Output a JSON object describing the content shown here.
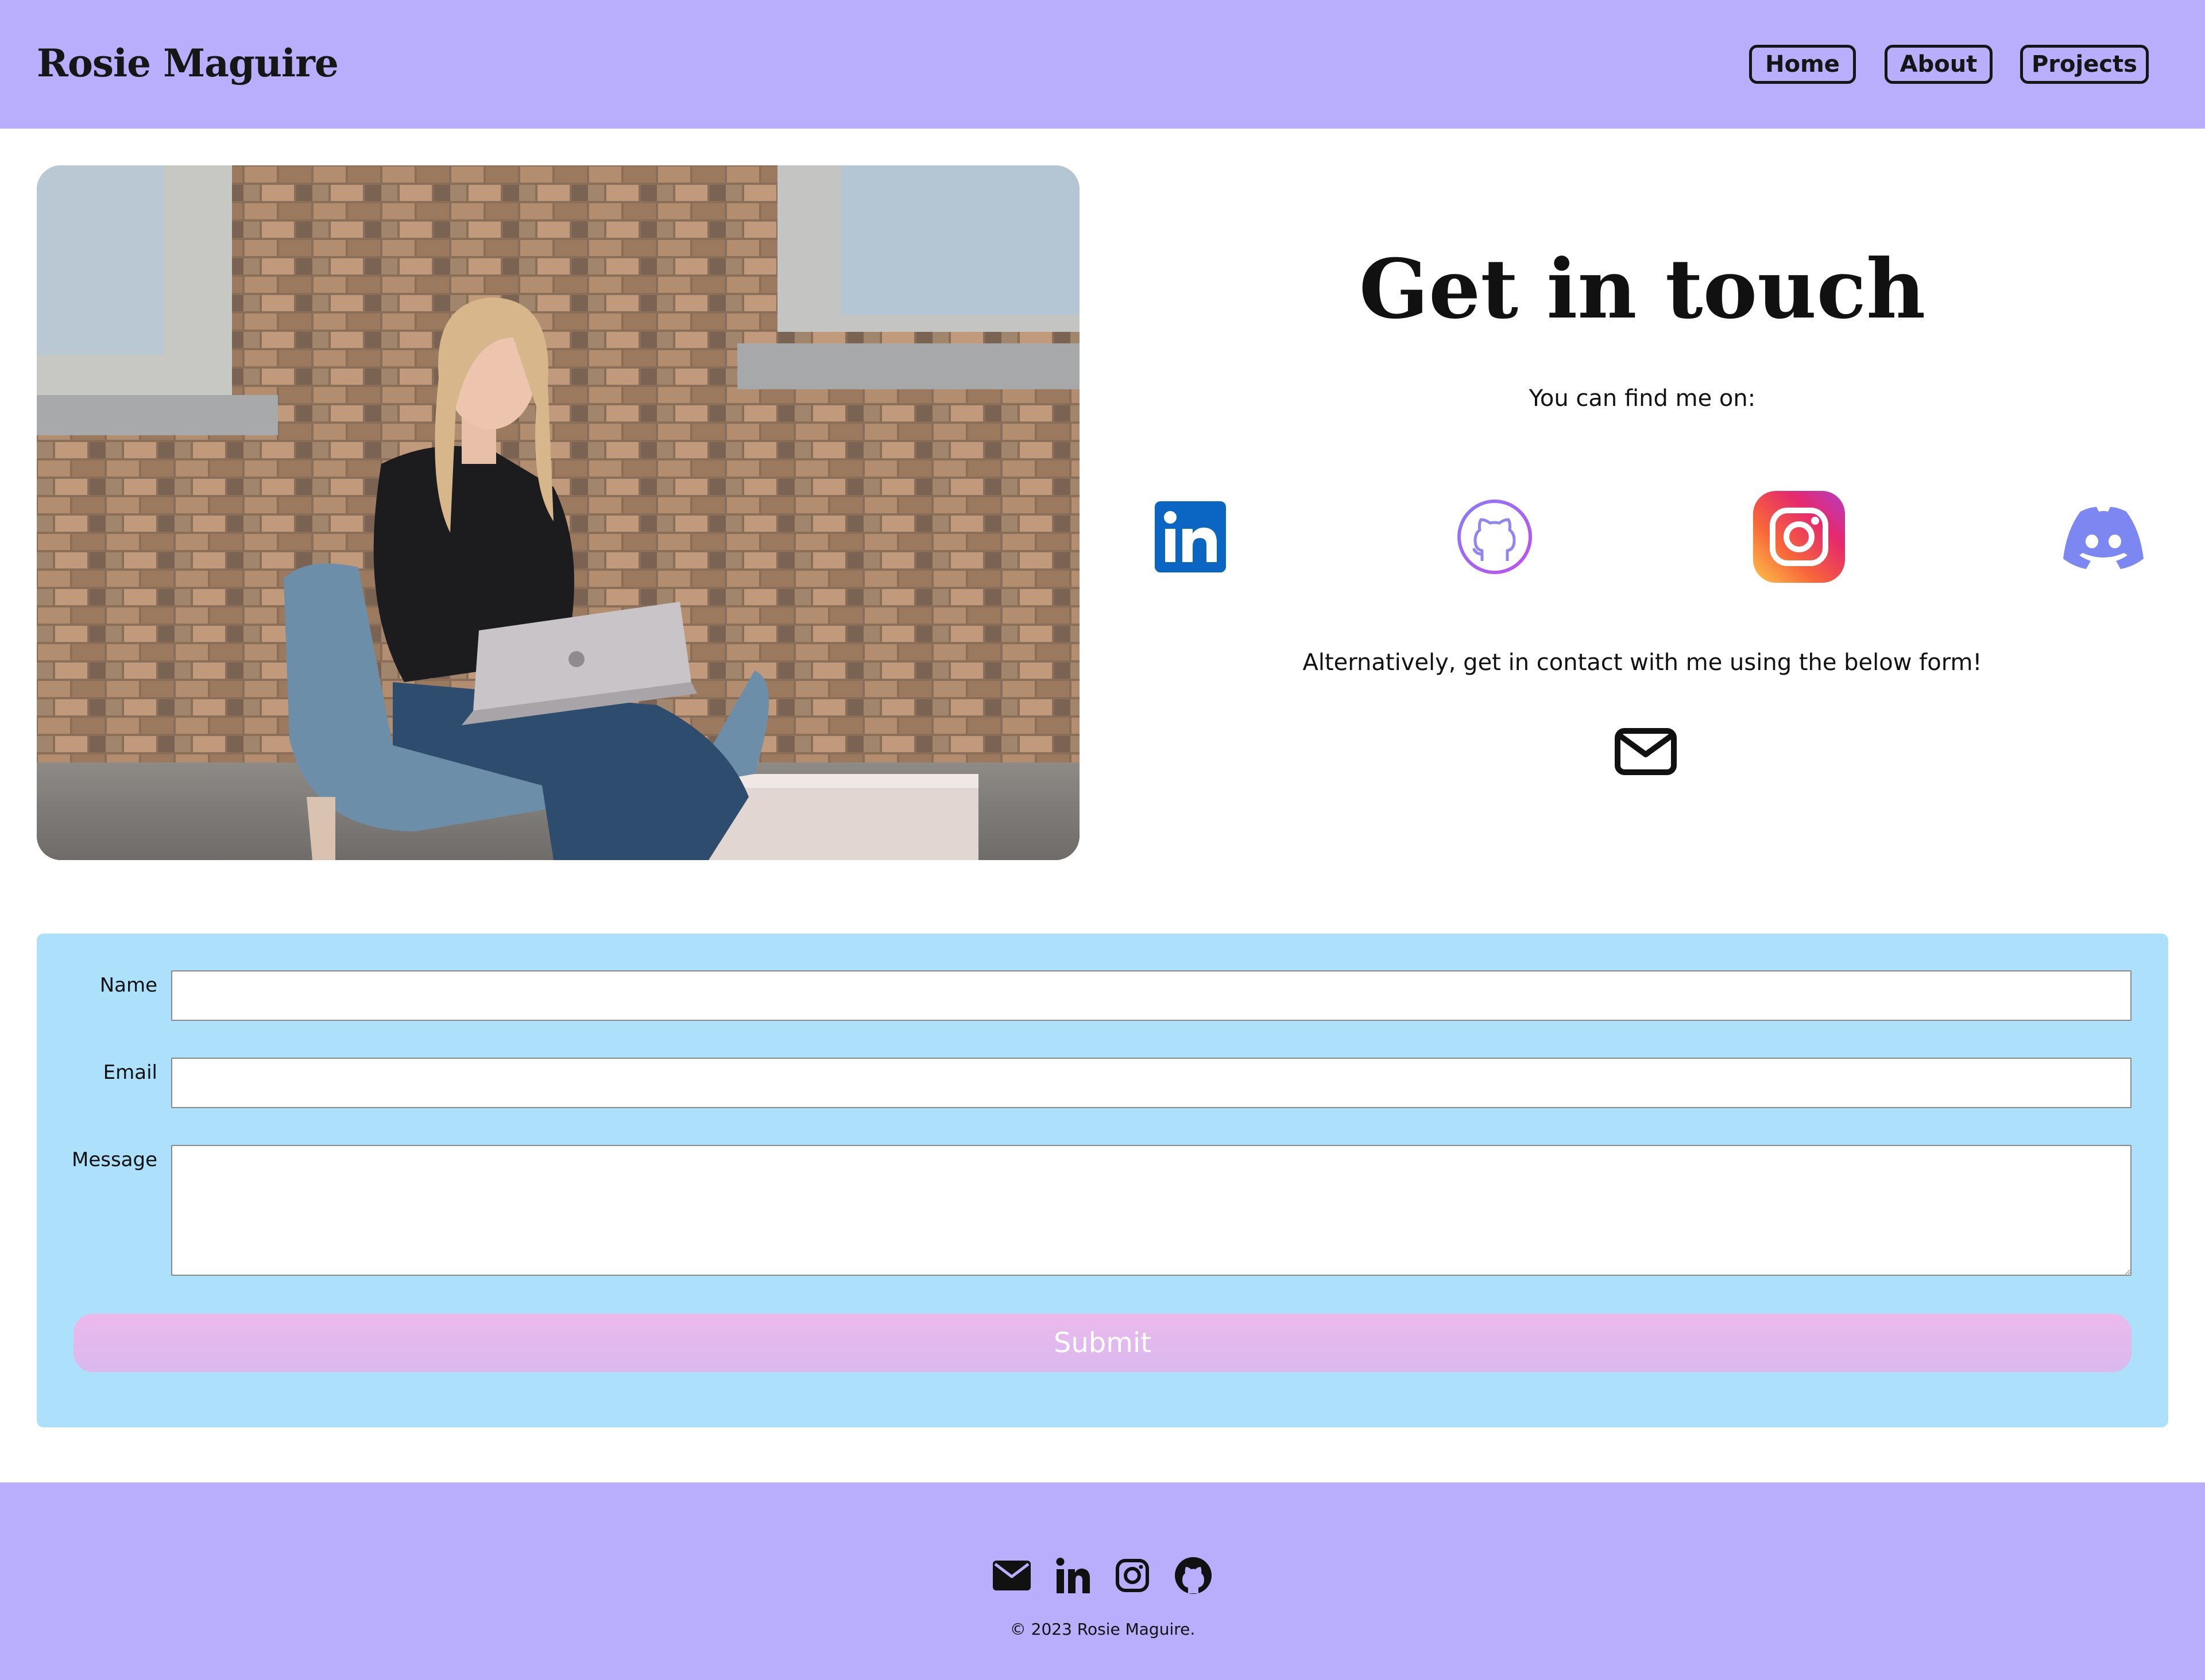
{
  "header": {
    "brand": "Rosie Maguire",
    "nav": [
      "Home",
      "About",
      "Projects"
    ]
  },
  "contact": {
    "title": "Get in touch",
    "find_text": "You can find me on:",
    "socials": [
      "linkedin-icon",
      "github-icon",
      "instagram-icon",
      "discord-icon"
    ],
    "alt_text": "Alternatively, get in contact with me using the below form!",
    "mail_icon": "envelope-icon"
  },
  "form": {
    "name_label": "Name",
    "name_value": "",
    "email_label": "Email",
    "email_value": "",
    "message_label": "Message",
    "message_value": "",
    "submit_label": "Submit"
  },
  "footer": {
    "icons": [
      "envelope-icon",
      "linkedin-icon",
      "instagram-icon",
      "github-icon"
    ],
    "copyright": "© 2023 Rosie Maguire."
  },
  "colors": {
    "header_bg": "#b8aefc",
    "form_bg": "#ade0fb",
    "submit_gradient": [
      "#ecb9ec",
      "#d9b9ef"
    ],
    "linkedin": "#0a66c2",
    "discord": "#7d87f2"
  }
}
